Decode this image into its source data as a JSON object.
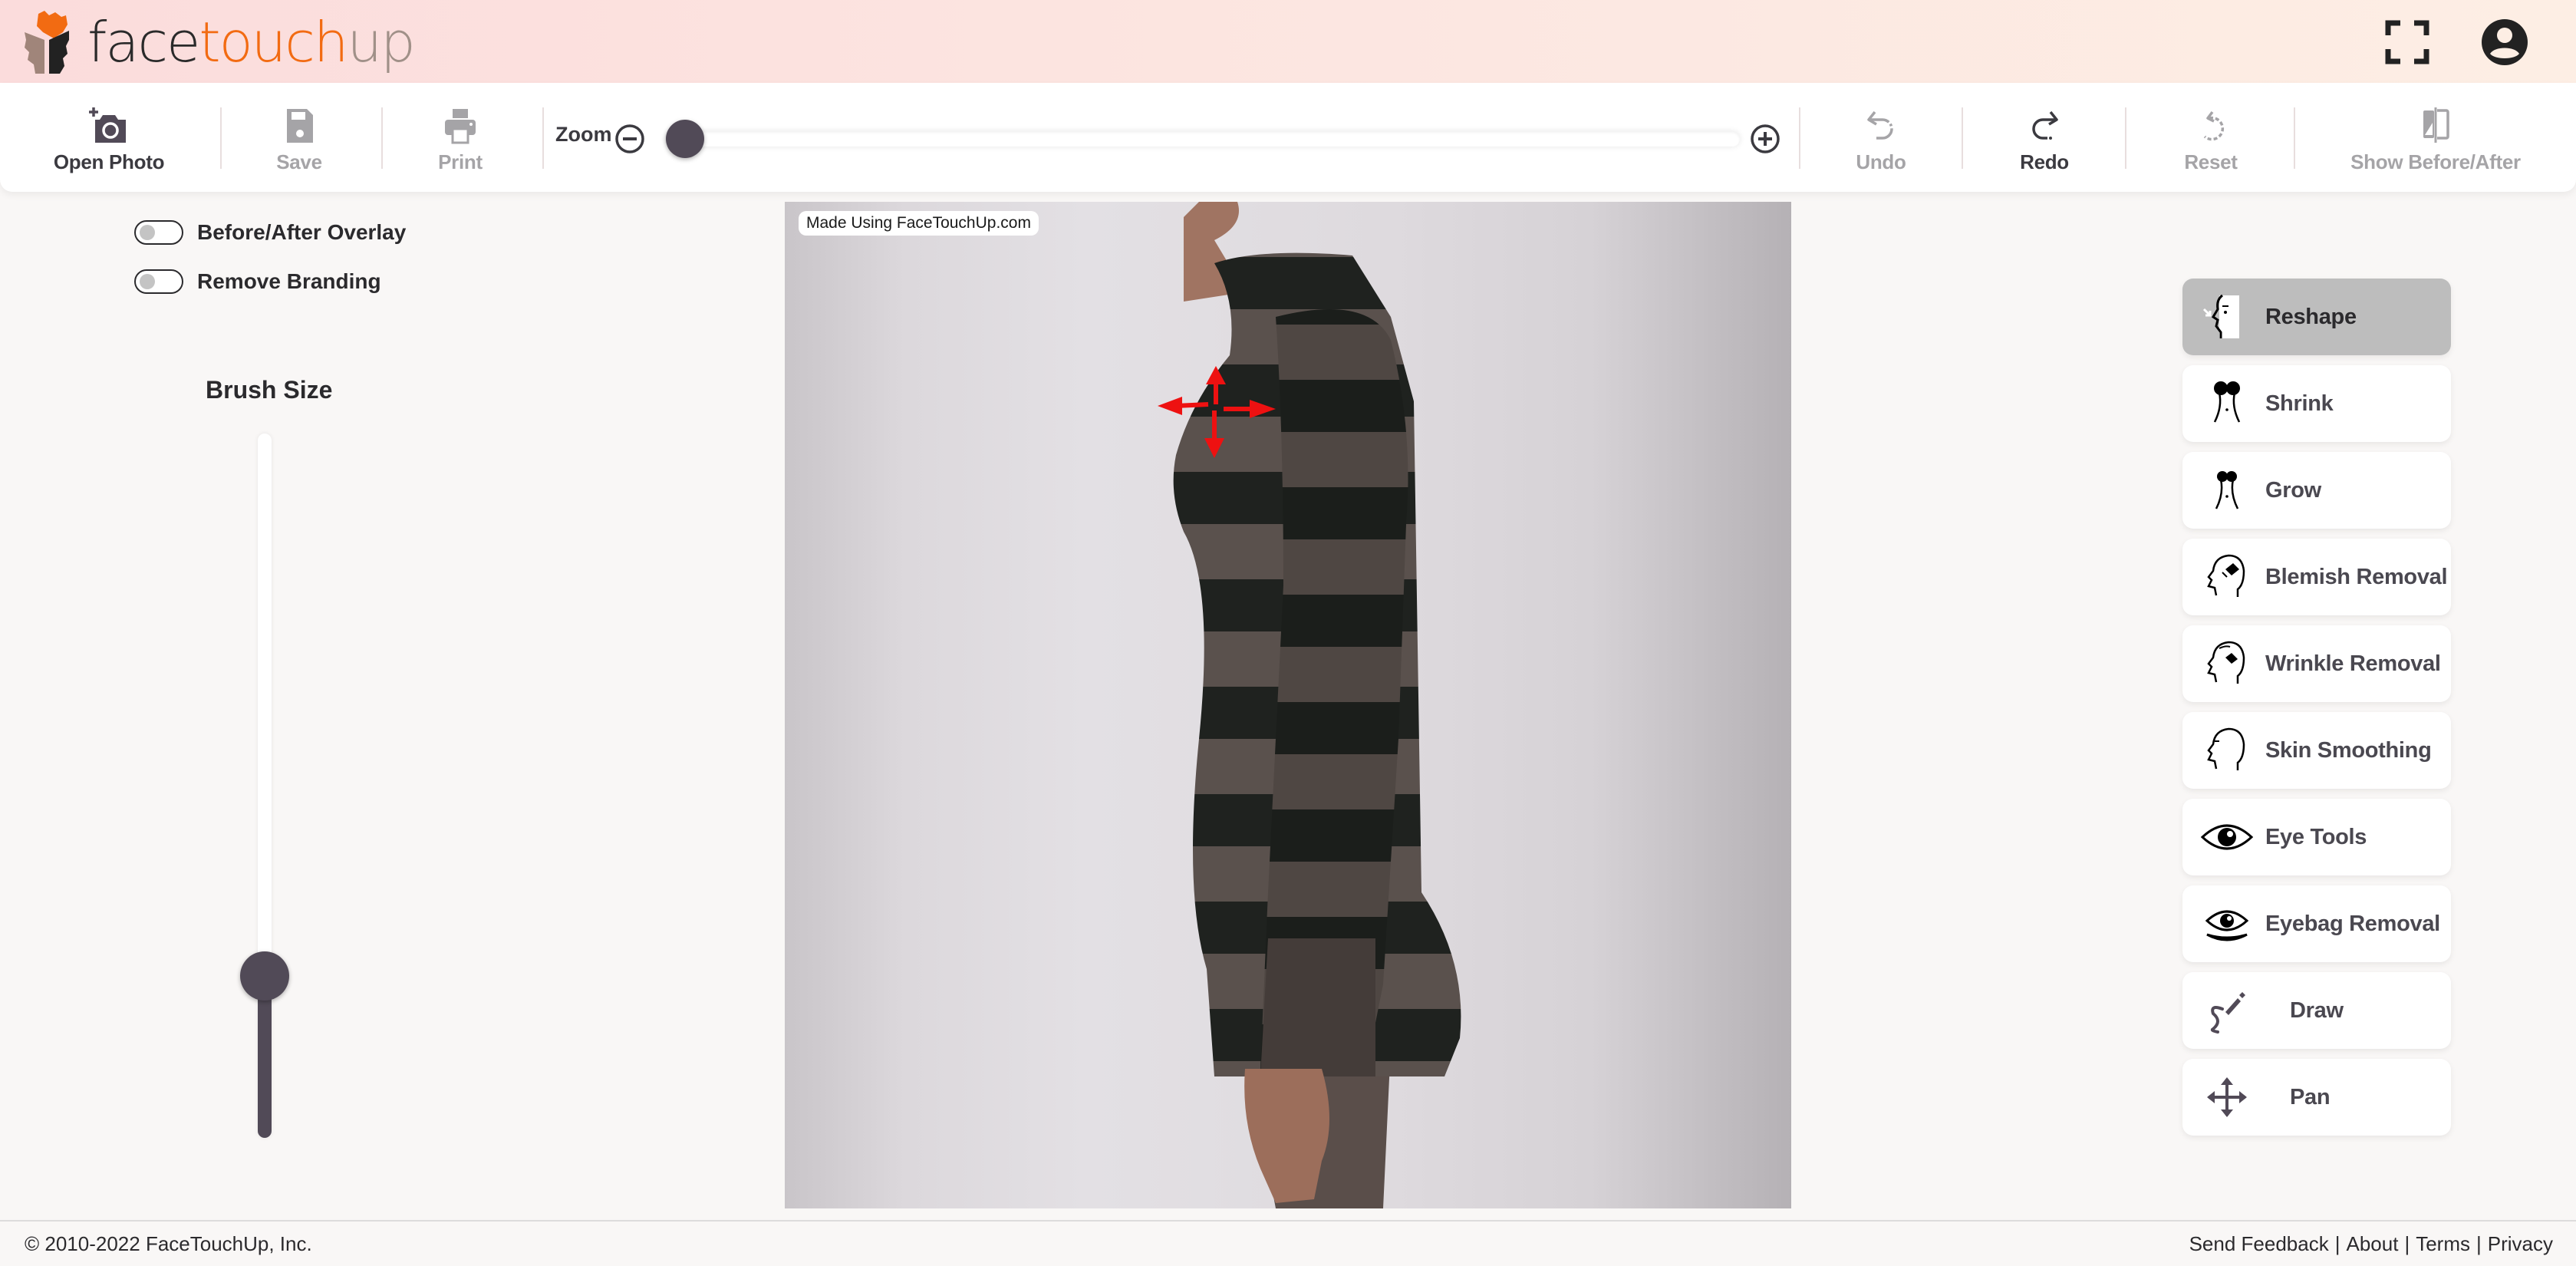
{
  "app": {
    "brand": {
      "part1": "face",
      "part2": "touch",
      "part3": "up"
    },
    "colors": {
      "accent": "#f26b12",
      "dark": "#514a57",
      "active_tool_bg": "#bdbdbd",
      "arrow": "#ee1111"
    }
  },
  "header": {
    "icons": [
      {
        "name": "fullscreen-icon"
      },
      {
        "name": "account-icon"
      }
    ]
  },
  "toolbar": {
    "open_photo": "Open Photo",
    "save": "Save",
    "print": "Print",
    "zoom_label": "Zoom",
    "zoom_value": 0,
    "undo": "Undo",
    "redo": "Redo",
    "reset": "Reset",
    "show_before_after": "Show Before/After",
    "states": {
      "open_photo": "enabled",
      "save": "disabled",
      "print": "disabled",
      "undo": "disabled",
      "redo": "enabled",
      "reset": "disabled",
      "show_before_after": "disabled"
    }
  },
  "left_panel": {
    "toggles": [
      {
        "label": "Before/After Overlay",
        "on": false
      },
      {
        "label": "Remove Branding",
        "on": false
      }
    ],
    "brush_size": {
      "title": "Brush Size",
      "value": 0.23
    }
  },
  "canvas": {
    "watermark": "Made Using FaceTouchUp.com",
    "reshape_cursor": "four-way-arrows"
  },
  "tools": [
    {
      "id": "reshape",
      "label": "Reshape",
      "icon": "reshape-face-icon",
      "active": true
    },
    {
      "id": "shrink",
      "label": "Shrink",
      "icon": "shrink-body-icon",
      "active": false
    },
    {
      "id": "grow",
      "label": "Grow",
      "icon": "grow-body-icon",
      "active": false
    },
    {
      "id": "blemish",
      "label": "Blemish Removal",
      "icon": "blemish-head-eraser-icon",
      "active": false
    },
    {
      "id": "wrinkle",
      "label": "Wrinkle Removal",
      "icon": "wrinkle-head-eraser-icon",
      "active": false
    },
    {
      "id": "skin",
      "label": "Skin Smoothing",
      "icon": "head-profile-icon",
      "active": false
    },
    {
      "id": "eye",
      "label": "Eye Tools",
      "icon": "eye-icon",
      "active": false
    },
    {
      "id": "eyebag",
      "label": "Eyebag Removal",
      "icon": "eyebag-icon",
      "active": false
    },
    {
      "id": "draw",
      "label": "Draw",
      "icon": "draw-pen-icon",
      "active": false
    },
    {
      "id": "pan",
      "label": "Pan",
      "icon": "pan-arrows-icon",
      "active": false
    }
  ],
  "footer": {
    "copyright": "© 2010-2022 FaceTouchUp, Inc.",
    "links": [
      "Send Feedback",
      "About",
      "Terms",
      "Privacy"
    ],
    "separator": "|"
  }
}
